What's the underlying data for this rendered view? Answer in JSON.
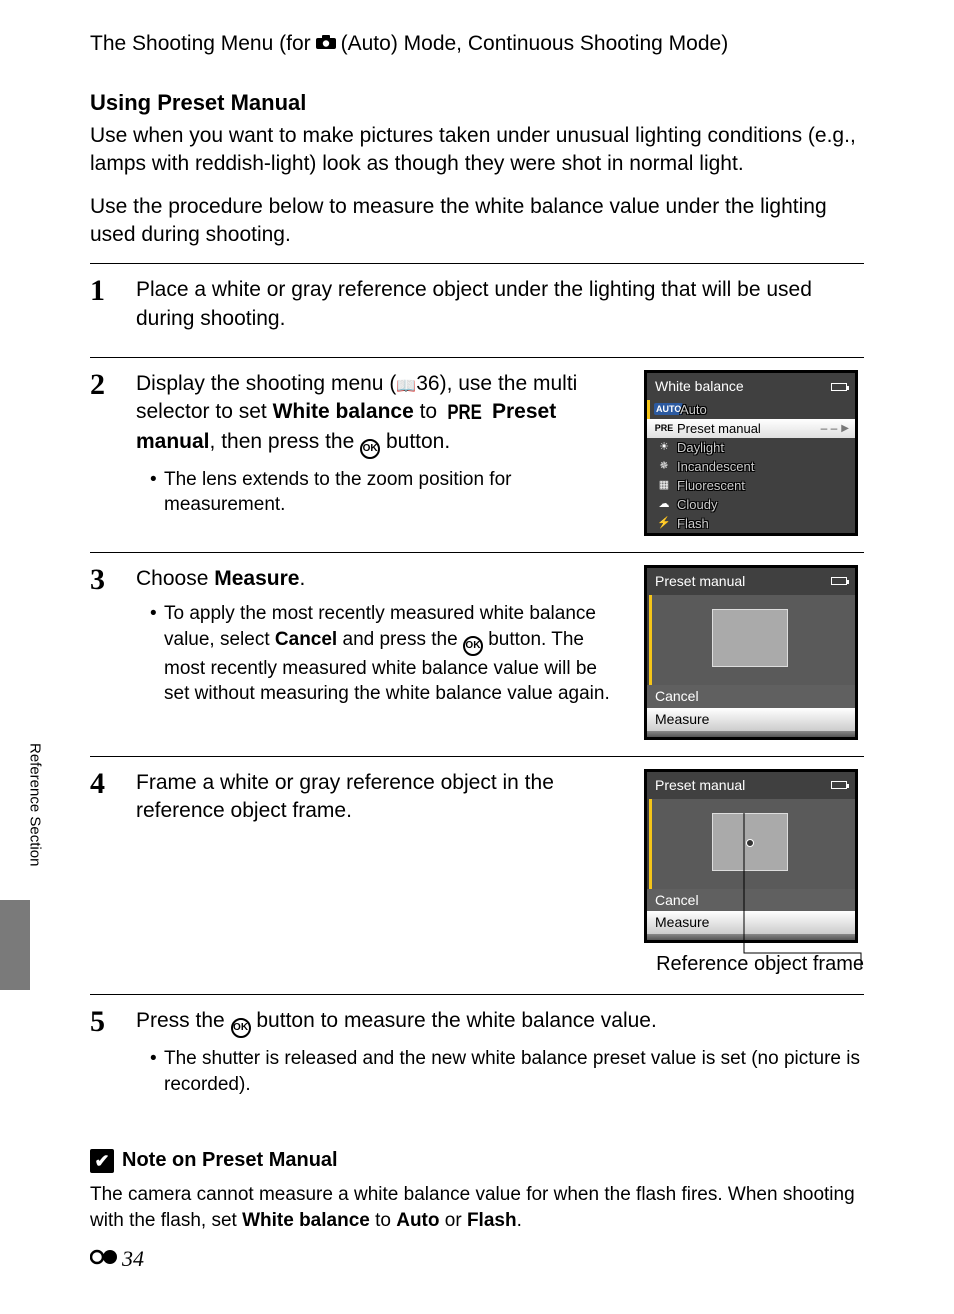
{
  "header": {
    "prefix": "The Shooting Menu (for ",
    "suffix": " (Auto) Mode, Continuous Shooting Mode)"
  },
  "section_heading": "Using Preset Manual",
  "intro": {
    "p1": "Use when you want to make pictures taken under unusual lighting conditions (e.g., lamps with reddish-light) look as though they were shot in normal light.",
    "p2": "Use the procedure below to measure the white balance value under the lighting used during shooting."
  },
  "steps": {
    "s1": {
      "num": "1",
      "text": "Place a white or gray reference object under the lighting that will be used during shooting."
    },
    "s2": {
      "num": "2",
      "t1": "Display the shooting menu (",
      "ref": "36",
      "t2": "), use the multi selector to set ",
      "bold1": "White balance",
      "t3": " to ",
      "pre": "PRE",
      "bold2": " Preset manual",
      "t4": ", then press the ",
      "t5": " button.",
      "bullet": "The lens extends to the zoom position for measurement."
    },
    "s3": {
      "num": "3",
      "t1": "Choose ",
      "bold1": "Measure",
      "t2": ".",
      "b1a": "To apply the most recently measured white balance value, select ",
      "b1b": "Cancel",
      "b1c": " and press the ",
      "b1d": " button. The most recently measured white balance value will be set without measuring the white balance value again."
    },
    "s4": {
      "num": "4",
      "text": "Frame a white or gray reference object in the reference object frame.",
      "caption": "Reference object frame"
    },
    "s5": {
      "num": "5",
      "t1": "Press the ",
      "t2": " button to measure the white balance value.",
      "bullet": "The shutter is released and the new white balance preset value is set (no picture is recorded)."
    }
  },
  "lcd_wb": {
    "title": "White balance",
    "items": {
      "auto": "Auto",
      "preset": "Preset manual",
      "daylight": "Daylight",
      "incandescent": "Incandescent",
      "fluorescent": "Fluorescent",
      "cloudy": "Cloudy",
      "flash": "Flash"
    },
    "dashes": "– –"
  },
  "lcd_pm": {
    "title": "Preset manual",
    "cancel": "Cancel",
    "measure": "Measure"
  },
  "note": {
    "heading": "Note on Preset Manual",
    "b1": "The camera cannot measure a white balance value for when the flash fires. When shooting with the flash, set ",
    "bold1": "White balance",
    "b2": " to ",
    "bold2": "Auto",
    "b3": " or ",
    "bold3": "Flash",
    "b4": "."
  },
  "side_tab": "Reference Section",
  "page_number": "34"
}
